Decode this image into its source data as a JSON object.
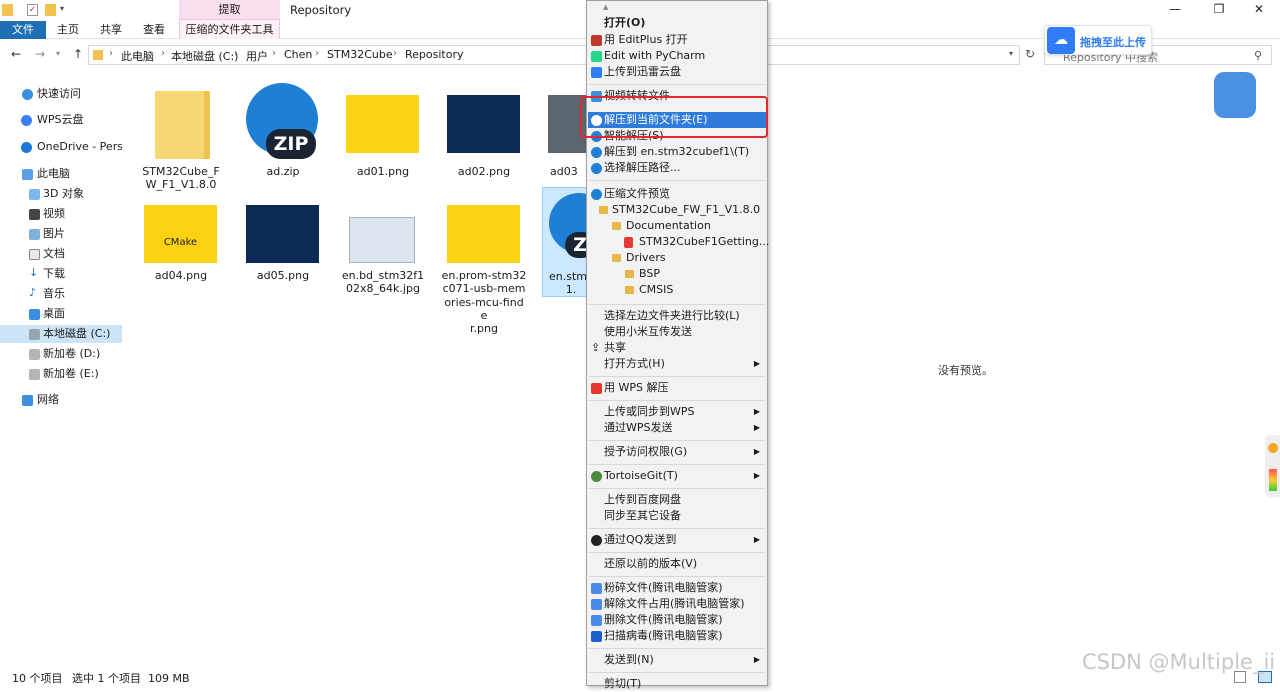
{
  "window": {
    "title": "Repository",
    "context_tab_header": "提取",
    "context_tab_label": "压缩的文件夹工具",
    "controls": [
      "—",
      "❐",
      "✕"
    ]
  },
  "ribbon": {
    "tabs": [
      "文件",
      "主页",
      "共享",
      "查看"
    ]
  },
  "address": {
    "breadcrumb": [
      "此电脑",
      "本地磁盘 (C:)",
      "用户",
      "Chen",
      "STM32Cube",
      "Repository"
    ],
    "search_placeholder": "Repository 中搜索"
  },
  "sidebar": {
    "items": [
      "快速访问",
      "WPS云盘",
      "OneDrive - Persor",
      "此电脑",
      "3D 对象",
      "视频",
      "图片",
      "文档",
      "下载",
      "音乐",
      "桌面",
      "本地磁盘 (C:)",
      "新加卷 (D:)",
      "新加卷 (E:)",
      "网络"
    ]
  },
  "files": [
    {
      "name": "STM32Cube_F\nW_F1_V1.8.0",
      "type": "folder"
    },
    {
      "name": "ad.zip",
      "type": "zip",
      "badge": "ZIP"
    },
    {
      "name": "ad01.png",
      "type": "image-yellow"
    },
    {
      "name": "ad02.png",
      "type": "image-blue"
    },
    {
      "name": "ad03",
      "type": "image-photo"
    },
    {
      "name": "ad04.png",
      "type": "image-yellow",
      "thumb_text": "CMake"
    },
    {
      "name": "ad05.png",
      "type": "image-blue"
    },
    {
      "name": "en.bd_stm32f1\n02x8_64k.jpg",
      "type": "image-diagram"
    },
    {
      "name": "en.prom-stm32\nc071-usb-mem\nories-mcu-finde\nr.png",
      "type": "image-yellow"
    },
    {
      "name": "en.stm3\n1.",
      "type": "zip",
      "badge": "Z"
    }
  ],
  "preview": {
    "empty_text": "没有预览。"
  },
  "status": {
    "count": "10 个项目",
    "selection": "选中 1 个项目  109 MB"
  },
  "upload_widget": {
    "label": "拖拽至此上传"
  },
  "watermark": "CSDN @Multiple_ii",
  "context_menu": {
    "items": [
      {
        "label": "打开(O)",
        "bold": true
      },
      {
        "label": "用 EditPlus 打开"
      },
      {
        "label": "Edit with PyCharm"
      },
      {
        "label": "上传到迅雷云盘"
      },
      {
        "label": "视频转转文件"
      },
      {
        "label": "解压到当前文件夹(E)",
        "highlighted": true
      },
      {
        "label": "智能解压(S)"
      },
      {
        "label": "解压到 en.stm32cubef1\\(T)"
      },
      {
        "label": "选择解压路径..."
      },
      {
        "label": "压缩文件预览"
      },
      {
        "label": "STM32Cube_FW_F1_V1.8.0"
      },
      {
        "label": "Documentation"
      },
      {
        "label": "STM32CubeF1Getting..."
      },
      {
        "label": "Drivers"
      },
      {
        "label": "BSP"
      },
      {
        "label": "CMSIS"
      },
      {
        "label": "选择左边文件夹进行比较(L)"
      },
      {
        "label": "使用小米互传发送"
      },
      {
        "label": "共享"
      },
      {
        "label": "打开方式(H)"
      },
      {
        "label": "用 WPS 解压"
      },
      {
        "label": "上传或同步到WPS"
      },
      {
        "label": "通过WPS发送"
      },
      {
        "label": "授予访问权限(G)"
      },
      {
        "label": "TortoiseGit(T)"
      },
      {
        "label": "上传到百度网盘"
      },
      {
        "label": "同步至其它设备"
      },
      {
        "label": "通过QQ发送到"
      },
      {
        "label": "还原以前的版本(V)"
      },
      {
        "label": "粉碎文件(腾讯电脑管家)"
      },
      {
        "label": "解除文件占用(腾讯电脑管家)"
      },
      {
        "label": "删除文件(腾讯电脑管家)"
      },
      {
        "label": "扫描病毒(腾讯电脑管家)"
      },
      {
        "label": "发送到(N)"
      },
      {
        "label": "剪切(T)"
      }
    ]
  },
  "colors": {
    "accent": "#1f6fb5",
    "highlight_border": "#e0282e",
    "menu_selected": "#2f7bdc"
  }
}
